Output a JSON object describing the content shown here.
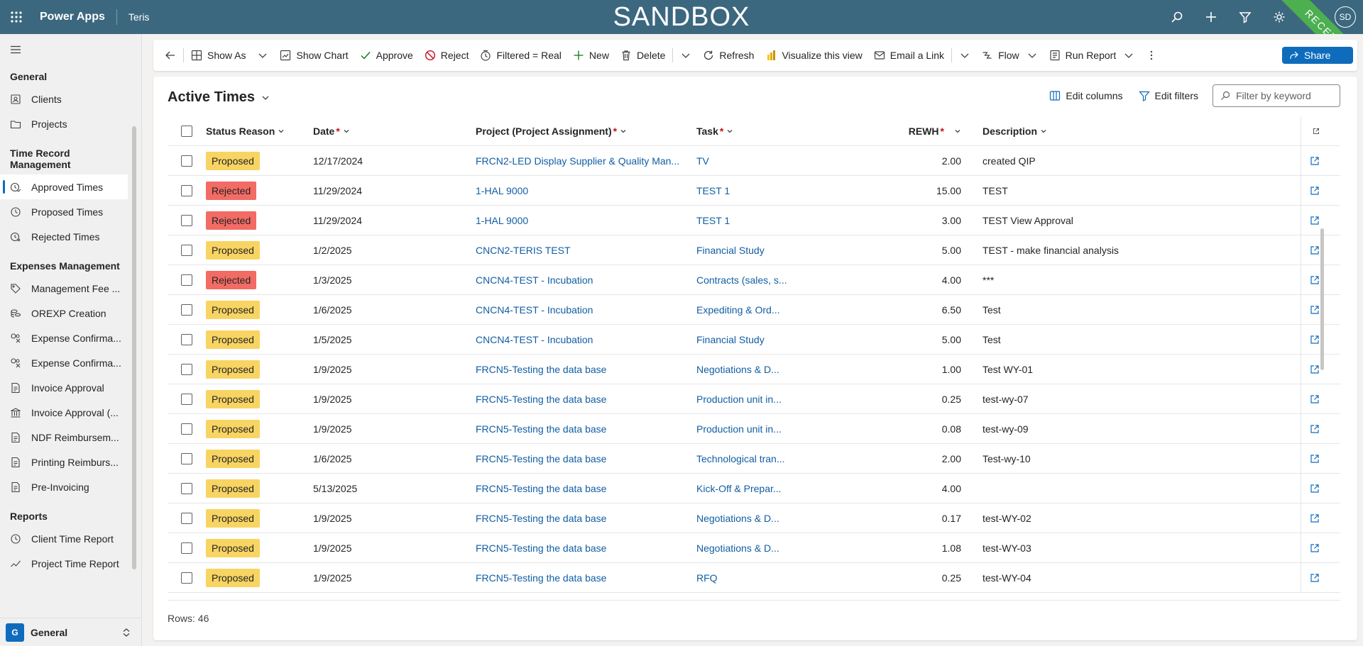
{
  "topbar": {
    "app_name": "Power Apps",
    "environment": "Teris",
    "banner": "SANDBOX",
    "avatar_initials": "SD",
    "ribbon": "RECETTE"
  },
  "sidebar": {
    "groups": [
      {
        "title": "General",
        "items": [
          {
            "label": "Clients",
            "icon": "contacts-icon"
          },
          {
            "label": "Projects",
            "icon": "folder-icon"
          }
        ]
      },
      {
        "title": "Time Record Management",
        "items": [
          {
            "label": "Approved Times",
            "icon": "clock-check-icon",
            "active": true
          },
          {
            "label": "Proposed Times",
            "icon": "clock-icon"
          },
          {
            "label": "Rejected Times",
            "icon": "clock-x-icon"
          }
        ]
      },
      {
        "title": "Expenses Management",
        "items": [
          {
            "label": "Management Fee ...",
            "icon": "tag-icon"
          },
          {
            "label": "OREXP Creation",
            "icon": "coins-icon"
          },
          {
            "label": "Expense Confirma...",
            "icon": "money-check-icon"
          },
          {
            "label": "Expense Confirma...",
            "icon": "money-check-icon"
          },
          {
            "label": "Invoice Approval",
            "icon": "document-icon"
          },
          {
            "label": "Invoice Approval (...",
            "icon": "bank-icon"
          },
          {
            "label": "NDF Reimbursem...",
            "icon": "document-icon"
          },
          {
            "label": "Printing Reimburs...",
            "icon": "document-icon"
          },
          {
            "label": "Pre-Invoicing",
            "icon": "document-icon"
          }
        ]
      },
      {
        "title": "Reports",
        "items": [
          {
            "label": "Client Time Report",
            "icon": "clock-icon"
          },
          {
            "label": "Project Time Report",
            "icon": "line-chart-icon"
          }
        ]
      }
    ],
    "area": {
      "badge": "G",
      "label": "General"
    }
  },
  "commands": {
    "show_as": "Show As",
    "show_chart": "Show Chart",
    "approve": "Approve",
    "reject": "Reject",
    "filtered": "Filtered = Real",
    "new": "New",
    "delete": "Delete",
    "refresh": "Refresh",
    "visualize": "Visualize this view",
    "email_link": "Email a Link",
    "flow": "Flow",
    "run_report": "Run Report",
    "share": "Share"
  },
  "view": {
    "title": "Active Times",
    "edit_columns": "Edit columns",
    "edit_filters": "Edit filters",
    "filter_placeholder": "Filter by keyword",
    "rows_count": "Rows: 46"
  },
  "grid": {
    "headers": {
      "status": "Status Reason",
      "date": "Date",
      "project": "Project (Project Assignment)",
      "task": "Task",
      "rewh": "REWH",
      "description": "Description",
      "required_mark": "*"
    },
    "rows": [
      {
        "status": "Proposed",
        "date": "12/17/2024",
        "project": "FRCN2-LED Display Supplier & Quality Man...",
        "task": "TV",
        "rewh": "2.00",
        "description": "created QIP"
      },
      {
        "status": "Rejected",
        "date": "11/29/2024",
        "project": "1-HAL 9000",
        "task": "TEST 1",
        "rewh": "15.00",
        "description": "TEST"
      },
      {
        "status": "Rejected",
        "date": "11/29/2024",
        "project": "1-HAL 9000",
        "task": "TEST 1",
        "rewh": "3.00",
        "description": "TEST View Approval"
      },
      {
        "status": "Proposed",
        "date": "1/2/2025",
        "project": "CNCN2-TERIS TEST",
        "task": "Financial Study",
        "rewh": "5.00",
        "description": "TEST - make financial analysis"
      },
      {
        "status": "Rejected",
        "date": "1/3/2025",
        "project": "CNCN4-TEST - Incubation",
        "task": "Contracts (sales, s...",
        "rewh": "4.00",
        "description": "***"
      },
      {
        "status": "Proposed",
        "date": "1/6/2025",
        "project": "CNCN4-TEST - Incubation",
        "task": "Expediting & Ord...",
        "rewh": "6.50",
        "description": "Test"
      },
      {
        "status": "Proposed",
        "date": "1/5/2025",
        "project": "CNCN4-TEST - Incubation",
        "task": "Financial Study",
        "rewh": "5.00",
        "description": "Test"
      },
      {
        "status": "Proposed",
        "date": "1/9/2025",
        "project": "FRCN5-Testing the data base",
        "task": "Negotiations & D...",
        "rewh": "1.00",
        "description": "Test WY-01"
      },
      {
        "status": "Proposed",
        "date": "1/9/2025",
        "project": "FRCN5-Testing the data base",
        "task": "Production unit in...",
        "rewh": "0.25",
        "description": "test-wy-07"
      },
      {
        "status": "Proposed",
        "date": "1/9/2025",
        "project": "FRCN5-Testing the data base",
        "task": "Production unit in...",
        "rewh": "0.08",
        "description": "test-wy-09"
      },
      {
        "status": "Proposed",
        "date": "1/6/2025",
        "project": "FRCN5-Testing the data base",
        "task": "Technological tran...",
        "rewh": "2.00",
        "description": "Test-wy-10"
      },
      {
        "status": "Proposed",
        "date": "5/13/2025",
        "project": "FRCN5-Testing the data base",
        "task": "Kick-Off & Prepar...",
        "rewh": "4.00",
        "description": ""
      },
      {
        "status": "Proposed",
        "date": "1/9/2025",
        "project": "FRCN5-Testing the data base",
        "task": "Negotiations & D...",
        "rewh": "0.17",
        "description": "test-WY-02"
      },
      {
        "status": "Proposed",
        "date": "1/9/2025",
        "project": "FRCN5-Testing the data base",
        "task": "Negotiations & D...",
        "rewh": "1.08",
        "description": "test-WY-03"
      },
      {
        "status": "Proposed",
        "date": "1/9/2025",
        "project": "FRCN5-Testing the data base",
        "task": "RFQ",
        "rewh": "0.25",
        "description": "test-WY-04"
      }
    ]
  },
  "colors": {
    "topbar": "#3c687f",
    "accent": "#0f6cbd",
    "proposed": "#f8d462",
    "rejected": "#f26b64",
    "ribbon": "#4caf50"
  }
}
